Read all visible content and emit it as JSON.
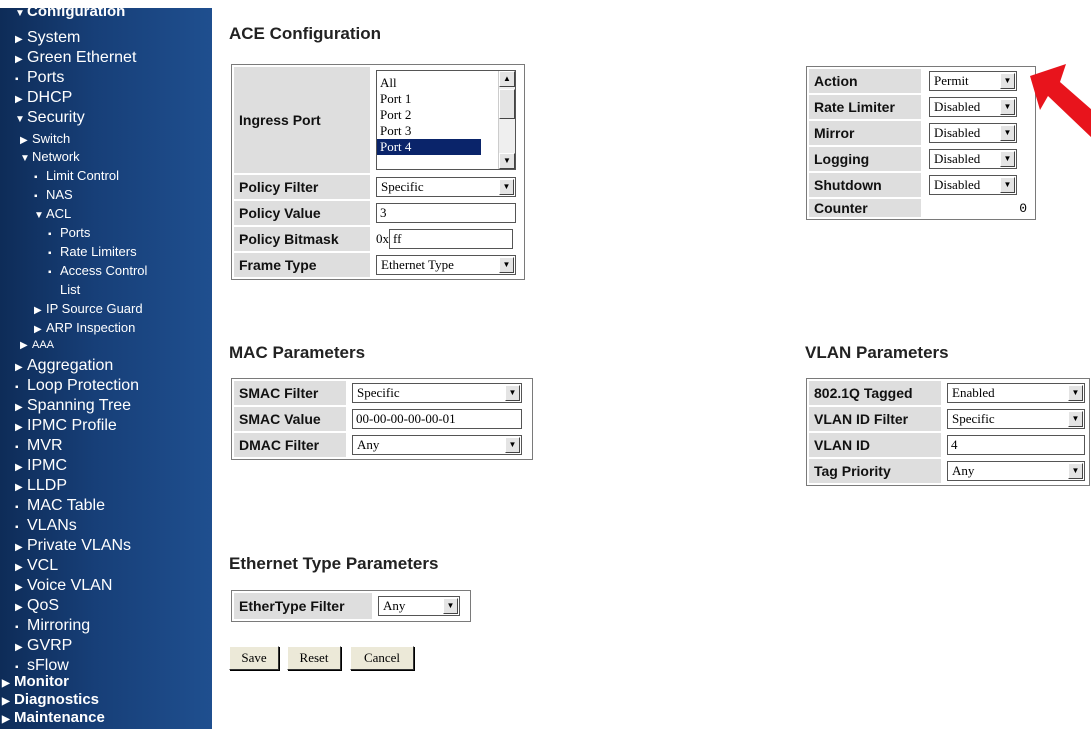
{
  "sidebar": {
    "items": [
      {
        "marker": "▼",
        "label": "Configuration"
      },
      {
        "marker": "▶",
        "label": "System"
      },
      {
        "marker": "▶",
        "label": "Green Ethernet"
      },
      {
        "marker": "▪",
        "label": "Ports"
      },
      {
        "marker": "▶",
        "label": "DHCP"
      },
      {
        "marker": "▼",
        "label": "Security"
      },
      {
        "marker": "▶",
        "label": "Switch"
      },
      {
        "marker": "▼",
        "label": "Network"
      },
      {
        "marker": "▪",
        "label": "Limit Control"
      },
      {
        "marker": "▪",
        "label": "NAS"
      },
      {
        "marker": "▼",
        "label": "ACL"
      },
      {
        "marker": "▪",
        "label": "Ports"
      },
      {
        "marker": "▪",
        "label": "Rate Limiters"
      },
      {
        "marker": "▪",
        "label": "Access Control"
      },
      {
        "marker": "",
        "label": "List"
      },
      {
        "marker": "▶",
        "label": "IP Source Guard"
      },
      {
        "marker": "▶",
        "label": "ARP Inspection"
      },
      {
        "marker": "▶",
        "label": "AAA"
      },
      {
        "marker": "▶",
        "label": "Aggregation"
      },
      {
        "marker": "▪",
        "label": "Loop Protection"
      },
      {
        "marker": "▶",
        "label": "Spanning Tree"
      },
      {
        "marker": "▶",
        "label": "IPMC Profile"
      },
      {
        "marker": "▪",
        "label": "MVR"
      },
      {
        "marker": "▶",
        "label": "IPMC"
      },
      {
        "marker": "▶",
        "label": "LLDP"
      },
      {
        "marker": "▪",
        "label": "MAC Table"
      },
      {
        "marker": "▪",
        "label": "VLANs"
      },
      {
        "marker": "▶",
        "label": "Private VLANs"
      },
      {
        "marker": "▶",
        "label": "VCL"
      },
      {
        "marker": "▶",
        "label": "Voice VLAN"
      },
      {
        "marker": "▶",
        "label": "QoS"
      },
      {
        "marker": "▪",
        "label": "Mirroring"
      },
      {
        "marker": "▶",
        "label": "GVRP"
      },
      {
        "marker": "▪",
        "label": "sFlow"
      },
      {
        "marker": "▶",
        "label": "Monitor"
      },
      {
        "marker": "▶",
        "label": "Diagnostics"
      },
      {
        "marker": "▶",
        "label": "Maintenance"
      }
    ]
  },
  "ace": {
    "heading": "ACE Configuration",
    "ingress_port_label": "Ingress Port",
    "ingress_port_options": [
      "All",
      "Port 1",
      "Port 2",
      "Port 3",
      "Port 4"
    ],
    "ingress_port_selected": "Port 4",
    "policy_filter_label": "Policy Filter",
    "policy_filter_value": "Specific",
    "policy_value_label": "Policy Value",
    "policy_value": "3",
    "policy_bitmask_label": "Policy Bitmask",
    "policy_bitmask_prefix": "0x",
    "policy_bitmask_value": "ff",
    "frame_type_label": "Frame Type",
    "frame_type_value": "Ethernet Type"
  },
  "action": {
    "action_label": "Action",
    "action_value": "Permit",
    "rate_limiter_label": "Rate Limiter",
    "rate_limiter_value": "Disabled",
    "mirror_label": "Mirror",
    "mirror_value": "Disabled",
    "logging_label": "Logging",
    "logging_value": "Disabled",
    "shutdown_label": "Shutdown",
    "shutdown_value": "Disabled",
    "counter_label": "Counter",
    "counter_value": "0"
  },
  "mac": {
    "heading": "MAC Parameters",
    "smac_filter_label": "SMAC Filter",
    "smac_filter_value": "Specific",
    "smac_value_label": "SMAC Value",
    "smac_value": "00-00-00-00-00-01",
    "dmac_filter_label": "DMAC Filter",
    "dmac_filter_value": "Any"
  },
  "vlan": {
    "heading": "VLAN Parameters",
    "tagged_label": "802.1Q Tagged",
    "tagged_value": "Enabled",
    "vlan_id_filter_label": "VLAN ID Filter",
    "vlan_id_filter_value": "Specific",
    "vlan_id_label": "VLAN ID",
    "vlan_id_value": "4",
    "tag_priority_label": "Tag Priority",
    "tag_priority_value": "Any"
  },
  "ethertype": {
    "heading": "Ethernet Type Parameters",
    "filter_label": "EtherType Filter",
    "filter_value": "Any"
  },
  "buttons": {
    "save": "Save",
    "reset": "Reset",
    "cancel": "Cancel"
  },
  "colors": {
    "sidebar_dark": "#0e2c58",
    "sidebar_light": "#1f4f8f",
    "label_bg": "#dedede",
    "selected_option": "#0a246a",
    "annotation_arrow": "#e8141c"
  },
  "icons": {
    "dropdown": "triangle-down",
    "annotation": "red-arrow"
  }
}
